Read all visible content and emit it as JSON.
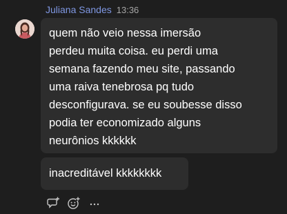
{
  "message": {
    "author": "Juliana Sandes",
    "timestamp": "13:36",
    "avatar_icon": "user-avatar",
    "text_lines": [
      "quem não veio nessa imersão",
      "perdeu muita coisa. eu perdi uma",
      "semana fazendo meu site, passando",
      "uma raiva tenebrosa pq tudo",
      "desconfigurava. se eu soubesse disso",
      "podia ter economizado alguns",
      "neurônios kkkkkk"
    ],
    "reply_text": "inacreditável kkkkkkkk"
  },
  "actions": {
    "reply_icon": "reply-icon",
    "emoji_icon": "add-emoji-icon",
    "more_label": "···"
  },
  "colors": {
    "background": "#1e1e1e",
    "bubble": "#2d2d2d",
    "author": "#7f97e2",
    "timestamp": "#a6a6a6",
    "text": "#ffffff",
    "icon": "#c8c8c8"
  }
}
